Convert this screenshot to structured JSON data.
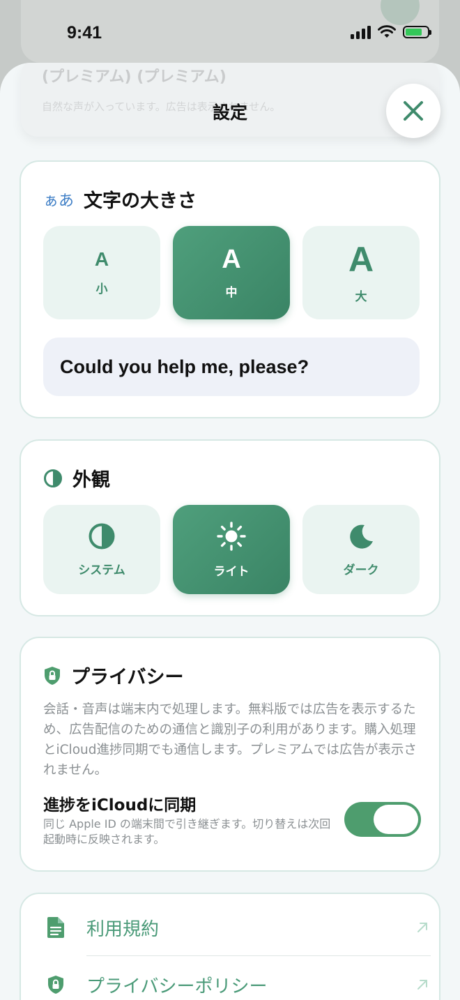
{
  "status_bar": {
    "time": "9:41"
  },
  "background": {
    "card_title": "(プレミアム) (プレミアム)",
    "card_desc": "自然な声が入っています。広告は表示されません。"
  },
  "sheet": {
    "title": "設定"
  },
  "text_size": {
    "icon_label": "ぁあ",
    "title": "文字の大きさ",
    "options": [
      {
        "glyph": "A",
        "label": "小"
      },
      {
        "glyph": "A",
        "label": "中"
      },
      {
        "glyph": "A",
        "label": "大"
      }
    ],
    "selected": "中",
    "sample": "Could you help me, please?"
  },
  "appearance": {
    "title": "外観",
    "options": [
      {
        "label": "システム",
        "icon": "half-circle-icon"
      },
      {
        "label": "ライト",
        "icon": "sun-icon"
      },
      {
        "label": "ダーク",
        "icon": "moon-icon"
      }
    ],
    "selected": "ライト"
  },
  "privacy": {
    "title": "プライバシー",
    "description": "会話・音声は端末内で処理します。無料版では広告を表示するため、広告配信のための通信と識別子の利用があります。購入処理とiCloud進捗同期でも通信します。プレミアムでは広告が表示されません。",
    "sync_title": "進捗をiCloudに同期",
    "sync_desc": "同じ Apple ID の端末間で引き継ぎます。切り替えは次回起動時に反映されます。",
    "sync_enabled": true
  },
  "links": [
    {
      "label": "利用規約",
      "icon": "document-icon"
    },
    {
      "label": "プライバシーポリシー",
      "icon": "lock-shield-icon"
    }
  ],
  "colors": {
    "accent": "#3f8b6c",
    "accent_dark": "#3a8465",
    "toggle_on": "#4e9d6e",
    "link": "#4a9a78"
  }
}
